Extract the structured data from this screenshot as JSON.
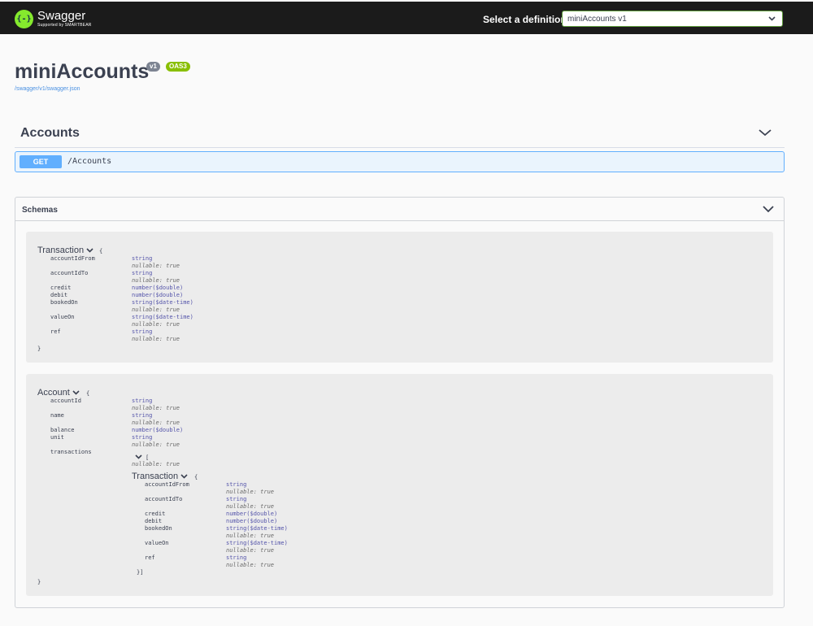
{
  "topbar": {
    "logo_mark": "{-}",
    "logo_title": "Swagger",
    "logo_sub": "Supported by SMARTBEAR",
    "definition_label": "Select a definition",
    "definition_value": "miniAccounts v1"
  },
  "info": {
    "title": "miniAccounts",
    "version_badge": "v1",
    "oas_badge": "OAS3",
    "spec_link": "/swagger/v1/swagger.json"
  },
  "tag": {
    "name": "Accounts",
    "operation": {
      "method": "GET",
      "path": "/Accounts"
    }
  },
  "schemas": {
    "heading": "Schemas",
    "transaction": {
      "name": "Transaction",
      "open": "{",
      "close": "}",
      "props": {
        "accountIdFrom": {
          "name": "accountIdFrom",
          "type": "string",
          "nullable": "nullable: true"
        },
        "accountIdTo": {
          "name": "accountIdTo",
          "type": "string",
          "nullable": "nullable: true"
        },
        "credit": {
          "name": "credit",
          "type": "number($double)"
        },
        "debit": {
          "name": "debit",
          "type": "number($double)"
        },
        "bookedOn": {
          "name": "bookedOn",
          "type": "string($date-time)",
          "nullable": "nullable: true"
        },
        "valueOn": {
          "name": "valueOn",
          "type": "string($date-time)",
          "nullable": "nullable: true"
        },
        "ref": {
          "name": "ref",
          "type": "string",
          "nullable": "nullable: true"
        }
      }
    },
    "account": {
      "name": "Account",
      "open": "{",
      "close": "}",
      "props": {
        "accountId": {
          "name": "accountId",
          "type": "string",
          "nullable": "nullable: true"
        },
        "name": {
          "name": "name",
          "type": "string",
          "nullable": "nullable: true"
        },
        "balance": {
          "name": "balance",
          "type": "number($double)"
        },
        "unit": {
          "name": "unit",
          "type": "string",
          "nullable": "nullable: true"
        },
        "transactions": {
          "name": "transactions",
          "array_open": "[",
          "nullable": "nullable: true",
          "array_close": "}]",
          "item": {
            "name": "Transaction",
            "open": "{",
            "props": {
              "accountIdFrom": {
                "name": "accountIdFrom",
                "type": "string",
                "nullable": "nullable: true"
              },
              "accountIdTo": {
                "name": "accountIdTo",
                "type": "string",
                "nullable": "nullable: true"
              },
              "credit": {
                "name": "credit",
                "type": "number($double)"
              },
              "debit": {
                "name": "debit",
                "type": "number($double)"
              },
              "bookedOn": {
                "name": "bookedOn",
                "type": "string($date-time)",
                "nullable": "nullable: true"
              },
              "valueOn": {
                "name": "valueOn",
                "type": "string($date-time)",
                "nullable": "nullable: true"
              },
              "ref": {
                "name": "ref",
                "type": "string",
                "nullable": "nullable: true"
              }
            }
          }
        }
      }
    }
  }
}
